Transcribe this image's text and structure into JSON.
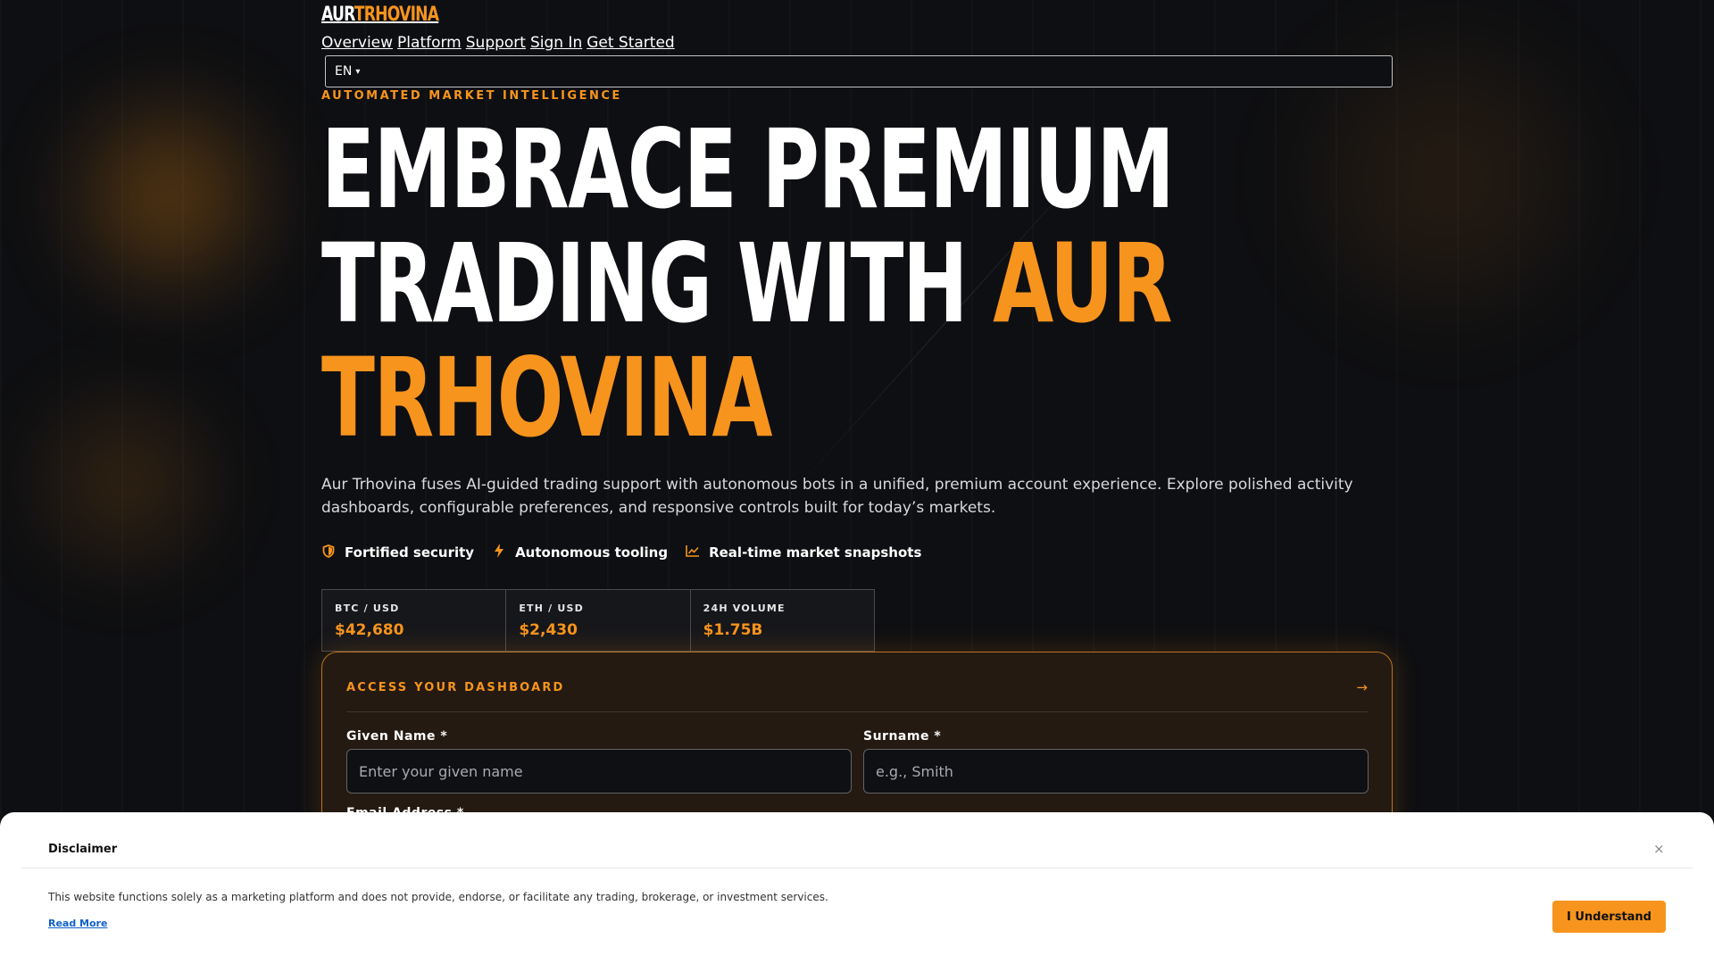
{
  "brand": {
    "logo_part1": "AUR",
    "logo_part2": "TRHOVINA"
  },
  "nav": {
    "items": [
      {
        "label": "Overview"
      },
      {
        "label": "Platform"
      },
      {
        "label": "Support"
      },
      {
        "label": "Sign In"
      },
      {
        "label": "Get Started"
      }
    ],
    "language": {
      "value": "EN",
      "caret": "▾"
    }
  },
  "hero": {
    "eyebrow": "AUTOMATED MARKET INTELLIGENCE",
    "headline_line1": "EMBRACE PREMIUM",
    "headline_line2_plain": "TRADING WITH ",
    "headline_line2_accent": "AUR",
    "headline_line3_accent": "TRHOVINA",
    "lead": "Aur Trhovina fuses AI-guided trading support with autonomous bots in a unified, premium account experience. Explore polished activity dashboards, configurable preferences, and responsive controls built for today’s markets.",
    "features": [
      {
        "icon": "shield-icon",
        "label": "Fortified security"
      },
      {
        "icon": "lightning-icon",
        "label": "Autonomous tooling"
      },
      {
        "icon": "chart-line-icon",
        "label": "Real-time market snapshots"
      }
    ]
  },
  "tickers": [
    {
      "pair": "BTC / USD",
      "price": "$42,680"
    },
    {
      "pair": "ETH / USD",
      "price": "$2,430"
    },
    {
      "pair": "24H VOLUME",
      "price": "$1.75B"
    }
  ],
  "dashboard": {
    "title": "ACCESS YOUR DASHBOARD",
    "arrow": "→",
    "given_name_label": "Given Name *",
    "given_name_placeholder": "Enter your given name",
    "surname_label": "Surname *",
    "surname_placeholder": "e.g., Smith",
    "email_label": "Email Address *"
  },
  "disclaimer": {
    "title": "Disclaimer",
    "close": "×",
    "text": "This website functions solely as a marketing platform and does not provide, endorse, or facilitate any trading, brokerage, or investment services.",
    "read_more": "Read More",
    "button": "I Understand"
  },
  "colors": {
    "accent": "#f7941d",
    "background": "#0e0f12",
    "link": "#1060c9"
  }
}
